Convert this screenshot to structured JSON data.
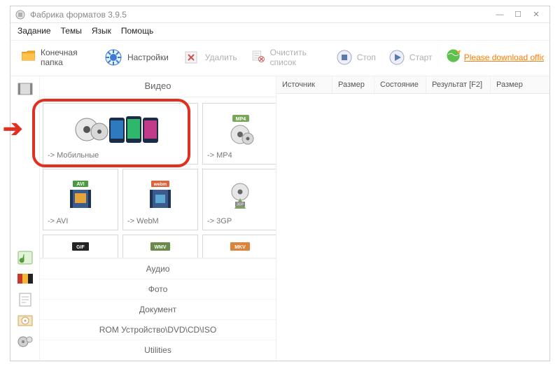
{
  "window": {
    "title": "Фабрика форматов 3.9.5"
  },
  "menu": [
    "Задание",
    "Темы",
    "Язык",
    "Помощь"
  ],
  "toolbar": {
    "dest_folder": "Конечная папка",
    "settings": "Настройки",
    "delete": "Удалить",
    "clear_list": "Очистить список",
    "stop": "Стоп",
    "start": "Старт",
    "download_link": "Please download official v"
  },
  "category_header": "Видео",
  "format_cells": {
    "mobile": "-> Мобильные",
    "mp4": "-> MP4",
    "avi": "-> AVI",
    "webm": "-> WebM",
    "gp3": "-> 3GP"
  },
  "badges": {
    "mp4": "MP4",
    "avi": "AVI",
    "webm": "webm",
    "gif": "GIF",
    "wmv": "WMV",
    "mkv": "MKV"
  },
  "categories": [
    "Аудио",
    "Фото",
    "Документ",
    "ROM Устройство\\DVD\\CD\\ISO",
    "Utilities"
  ],
  "columns": {
    "source": "Источник",
    "size1": "Размер",
    "state": "Состояние",
    "result": "Результат [F2]",
    "size2": "Размер"
  }
}
